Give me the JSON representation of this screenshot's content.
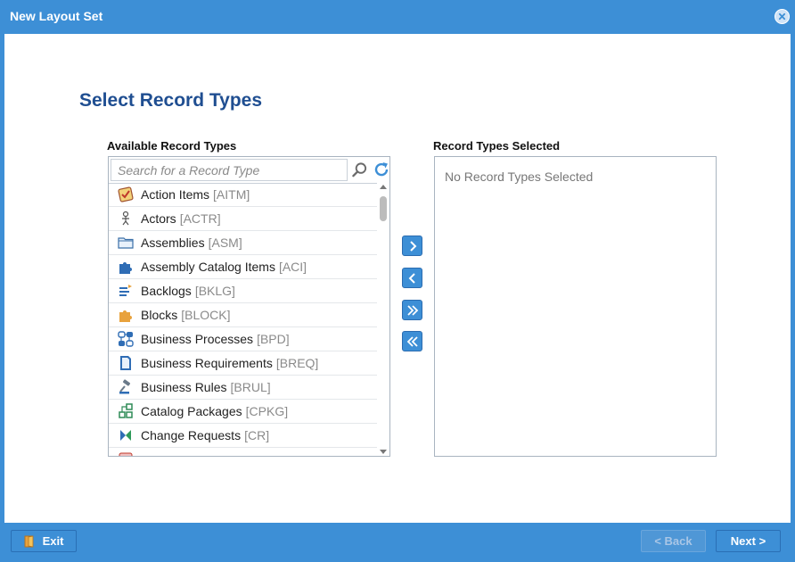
{
  "window": {
    "title": "New Layout Set"
  },
  "page": {
    "heading": "Select Record Types"
  },
  "available": {
    "label": "Available Record Types",
    "search_placeholder": "Search for a Record Type",
    "items": [
      {
        "name": "Action Items",
        "code": "[AITM]",
        "icon": "action-items-icon"
      },
      {
        "name": "Actors",
        "code": "[ACTR]",
        "icon": "actor-icon"
      },
      {
        "name": "Assemblies",
        "code": "[ASM]",
        "icon": "folder-icon"
      },
      {
        "name": "Assembly Catalog Items",
        "code": "[ACI]",
        "icon": "puzzle-blue-icon"
      },
      {
        "name": "Backlogs",
        "code": "[BKLG]",
        "icon": "backlog-icon"
      },
      {
        "name": "Blocks",
        "code": "[BLOCK]",
        "icon": "puzzle-orange-icon"
      },
      {
        "name": "Business Processes",
        "code": "[BPD]",
        "icon": "process-icon"
      },
      {
        "name": "Business Requirements",
        "code": "[BREQ]",
        "icon": "document-icon"
      },
      {
        "name": "Business Rules",
        "code": "[BRUL]",
        "icon": "gavel-icon"
      },
      {
        "name": "Catalog Packages",
        "code": "[CPKG]",
        "icon": "package-icon"
      },
      {
        "name": "Change Requests",
        "code": "[CR]",
        "icon": "change-request-icon"
      }
    ]
  },
  "selected": {
    "label": "Record Types Selected",
    "empty_message": "No Record Types Selected"
  },
  "footer": {
    "exit_label": "Exit",
    "back_label": "< Back",
    "next_label": "Next >"
  },
  "colors": {
    "accent": "#3d8fd6",
    "heading": "#1f4e91"
  }
}
